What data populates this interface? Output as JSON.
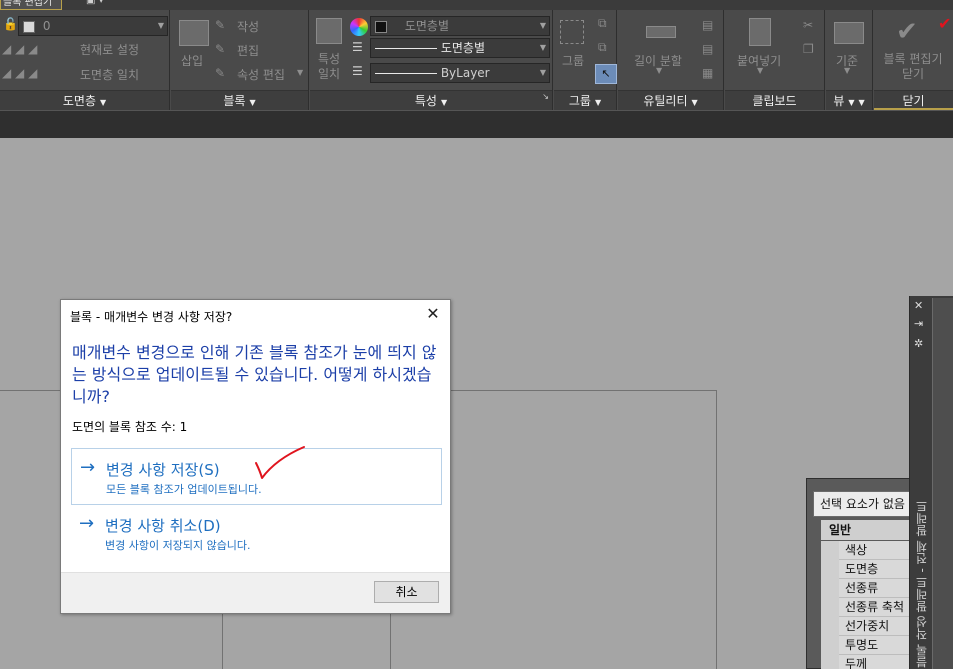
{
  "tab": {
    "active_label": "블록 편집기"
  },
  "panels": {
    "layers": {
      "title": "도면층",
      "layer_value": "0",
      "items": [
        "현재로 설정",
        "도면층 일치"
      ]
    },
    "block": {
      "title": "블록",
      "insert_label": "삽입",
      "items": [
        "작성",
        "편집",
        "속성 편집"
      ]
    },
    "properties": {
      "title": "특성",
      "match_label": "특성 일치",
      "color_value": "도면층별",
      "linetype_value": "도면층별",
      "lineweight_value": "ByLayer"
    },
    "group": {
      "title": "그룹",
      "group_label": "그룹"
    },
    "utilities": {
      "title": "유틸리티",
      "measure_label": "길이 분할"
    },
    "clipboard": {
      "title": "클립보드",
      "paste_label": "붙여넣기"
    },
    "view": {
      "title": "뷰",
      "base_label": "기준"
    },
    "close": {
      "title": "닫기",
      "close_label": "블록 편집기 닫기"
    }
  },
  "accent_colors": {
    "dialog_text": "#1c3fa8",
    "option_text": "#1f6fc0",
    "check_mark": "#e0141e",
    "ribbon_bg": "#4a4a4a",
    "drawing_bg": "#a5a5a5"
  },
  "dialog": {
    "title": "블록 - 매개변수 변경 사항 저장?",
    "message": "매개변수 변경으로 인해 기존 블록 참조가 눈에 띄지 않는 방식으로 업데이트될 수 있습니다. 어떻게 하시겠습니까?",
    "count_text": "도면의 블록 참조 수: 1",
    "options": [
      {
        "title": "변경 사항 저장(S)",
        "subtitle": "모든 블록 참조가 업데이트됩니다."
      },
      {
        "title": "변경 사항 취소(D)",
        "subtitle": "변경 사항이 저장되지 않습니다."
      }
    ],
    "cancel_label": "취소"
  },
  "properties_palette": {
    "selection": "선택 요소가 없음",
    "category": "일반",
    "rows": [
      "색상",
      "도면층",
      "선종류",
      "선종류 축척",
      "선가중치",
      "투명도",
      "두께"
    ],
    "side_tab": "블록 작성 팔레트 - 전체 팔레트"
  }
}
